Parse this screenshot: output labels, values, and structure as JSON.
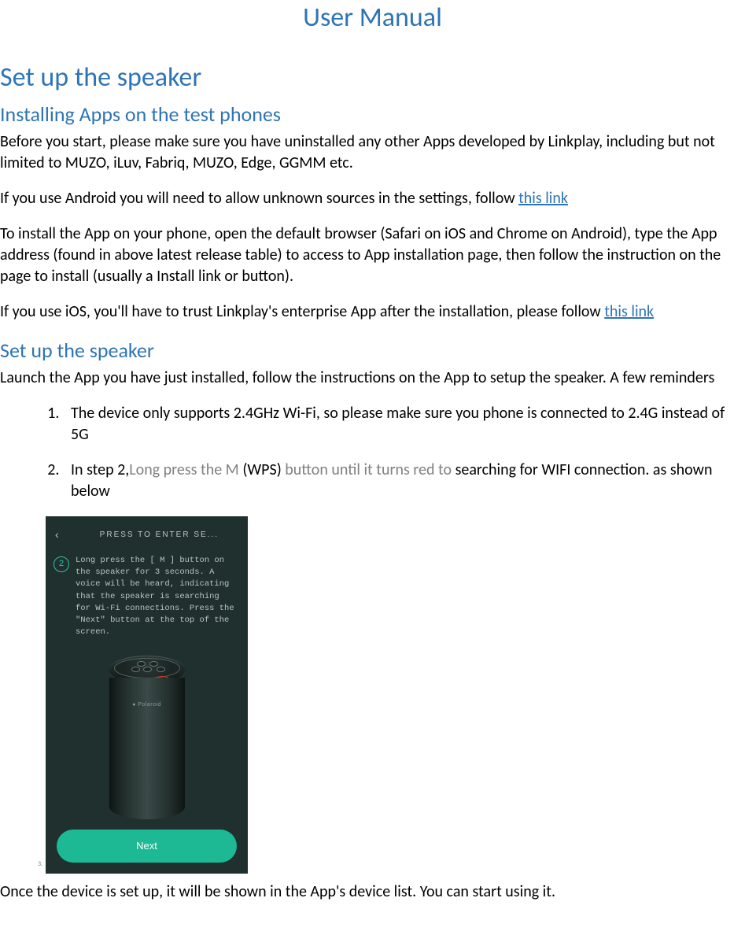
{
  "title": "User Manual",
  "section1": {
    "heading": "Set up the speaker",
    "sub1": {
      "heading": "Installing Apps on the test phones",
      "p1": "Before you start, please make sure you have uninstalled any other Apps developed by Linkplay, including but not limited to MUZO, iLuv, Fabriq, MUZO, Edge, GGMM etc.",
      "p2_a": "If you use Android you will need to allow unknown sources in the settings, follow ",
      "p2_link": "this link",
      "p3": "To install the App on your phone, open the default browser (Safari on iOS and Chrome on Android), type the App address (found in above latest release table) to access to App installation page, then follow the instruction on the page to install (usually a Install link or button).",
      "p4_a": "If you use iOS, you'll have to trust Linkplay's enterprise App after the installation, please follow ",
      "p4_link": "this link"
    },
    "sub2": {
      "heading": "Set up the speaker",
      "p1": "Launch the App you have just installed, follow the instructions on the App to setup the speaker. A few reminders",
      "li1": "The device only supports 2.4GHz Wi-Fi, so please make sure you phone is connected to 2.4G instead of 5G",
      "li2_a": "In step 2,",
      "li2_b": "Long press the M ",
      "li2_c": "(WPS)",
      "li2_d": " button until it turns red to ",
      "li2_e": "searching for WIFI connection. as shown below",
      "p_after": "Once the device is set up, it will be shown in the App's device list. You can start using it."
    }
  },
  "phone": {
    "header": "PRESS TO ENTER SE...",
    "back": "‹",
    "step": "2",
    "instruction": "Long press the [ M ] button on the speaker for 3 seconds. A voice will be heard, indicating that the speaker is searching for Wi-Fi connections. Press the \"Next\" button at the top of the screen.",
    "speaker_label": "● Polaroid",
    "next": "Next"
  },
  "tiny": "3."
}
